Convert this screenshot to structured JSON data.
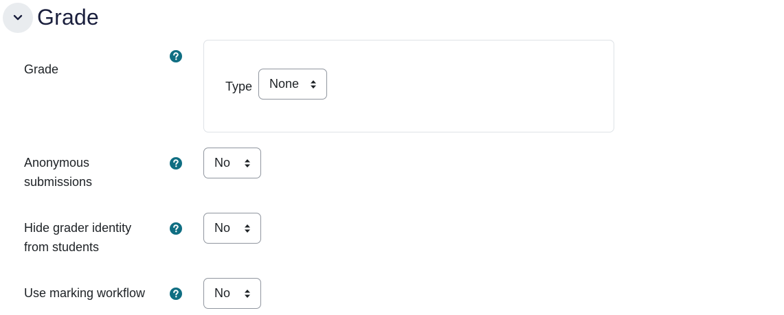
{
  "section": {
    "title": "Grade",
    "collapse_icon": "chevron-down-icon"
  },
  "fields": {
    "grade": {
      "label": "Grade",
      "type_label": "Type",
      "type_value": "None"
    },
    "anonymous_submissions": {
      "label_line1": "Anonymous",
      "label_line2": "submissions",
      "value": "No"
    },
    "hide_grader_identity": {
      "label_line1": "Hide grader identity",
      "label_line2": "from students",
      "value": "No"
    },
    "marking_workflow": {
      "label": "Use marking workflow",
      "value": "No"
    }
  },
  "colors": {
    "help_icon": "#0f6e82",
    "title": "#1a1f3d",
    "collapse_bg": "#e9ecef",
    "border": "#8f959e"
  },
  "icons": {
    "help": "question-circle-icon",
    "select_caret": "sort-caret-icon"
  }
}
